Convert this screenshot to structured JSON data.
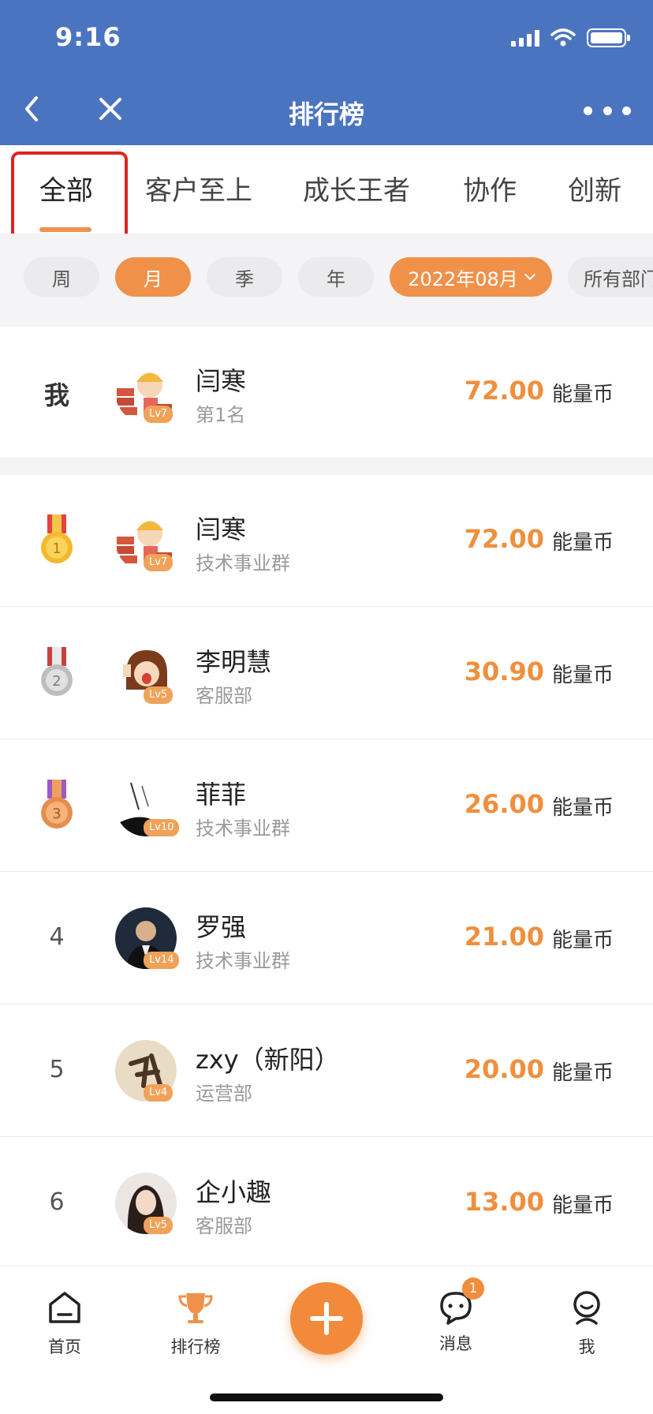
{
  "status": {
    "time": "9:16"
  },
  "nav": {
    "title": "排行榜"
  },
  "category_tabs": [
    {
      "label": "全部",
      "active": true
    },
    {
      "label": "客户至上",
      "active": false
    },
    {
      "label": "成长王者",
      "active": false
    },
    {
      "label": "协作",
      "active": false
    },
    {
      "label": "创新",
      "active": false
    }
  ],
  "filters": {
    "periods": [
      {
        "label": "周",
        "active": false
      },
      {
        "label": "月",
        "active": true
      },
      {
        "label": "季",
        "active": false
      },
      {
        "label": "年",
        "active": false
      }
    ],
    "date": "2022年08月",
    "department": "所有部门"
  },
  "me": {
    "rank_label": "我",
    "name": "闫寒",
    "sub": "第1名",
    "level": "Lv7",
    "score": "72.00",
    "unit": "能量币"
  },
  "rankings": [
    {
      "rank": "1",
      "medal": "gold",
      "name": "闫寒",
      "department": "技术事业群",
      "level": "Lv7",
      "score": "72.00",
      "unit": "能量币"
    },
    {
      "rank": "2",
      "medal": "silver",
      "name": "李明慧",
      "department": "客服部",
      "level": "Lv5",
      "score": "30.90",
      "unit": "能量币"
    },
    {
      "rank": "3",
      "medal": "bronze",
      "name": "菲菲",
      "department": "技术事业群",
      "level": "Lv10",
      "score": "26.00",
      "unit": "能量币"
    },
    {
      "rank": "4",
      "medal": "",
      "name": "罗强",
      "department": "技术事业群",
      "level": "Lv14",
      "score": "21.00",
      "unit": "能量币"
    },
    {
      "rank": "5",
      "medal": "",
      "name": "zxy（新阳）",
      "department": "运营部",
      "level": "Lv4",
      "score": "20.00",
      "unit": "能量币"
    },
    {
      "rank": "6",
      "medal": "",
      "name": "企小趣",
      "department": "客服部",
      "level": "Lv5",
      "score": "13.00",
      "unit": "能量币"
    }
  ],
  "tabbar": {
    "home": "首页",
    "ranking": "排行榜",
    "messages": "消息",
    "messages_badge": "1",
    "me": "我"
  },
  "colors": {
    "header": "#4b74c0",
    "accent": "#f0914a",
    "highlight_box": "#e02222"
  }
}
